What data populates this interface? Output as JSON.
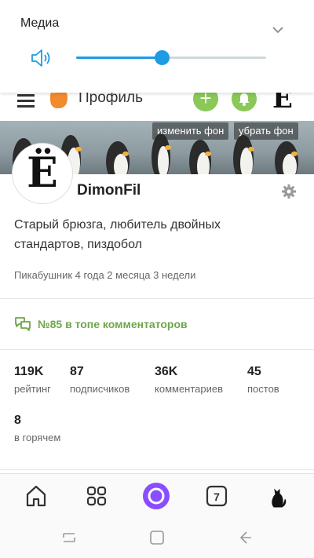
{
  "volume": {
    "title": "Медиа",
    "level_percent": 45,
    "accent_color": "#1d9be3"
  },
  "header": {
    "title": "Профиль",
    "add_label": "+",
    "avatar_letter": "Ё"
  },
  "cover": {
    "change_label": "изменить фон",
    "remove_label": "убрать фон"
  },
  "profile": {
    "avatar_letter": "Ё",
    "username": "DimonFil",
    "bio": "Старый брюзга, любитель двойных стандартов, пиздобол",
    "member_since": "Пикабушник 4 года 2 месяца 3 недели",
    "rank": "№85 в топе комментаторов",
    "accent_color": "#6ea64a"
  },
  "stats": [
    {
      "value": "119K",
      "label": "рейтинг"
    },
    {
      "value": "87",
      "label": "подписчиков"
    },
    {
      "value": "36K",
      "label": "комментариев"
    },
    {
      "value": "45",
      "label": "постов"
    },
    {
      "value": "8",
      "label": "в горячем"
    }
  ],
  "bottom_nav": {
    "items": [
      "home-icon",
      "apps-grid-icon",
      "alice-icon",
      "tabs-counter-icon",
      "cat-icon"
    ],
    "tabs_count": "7"
  }
}
